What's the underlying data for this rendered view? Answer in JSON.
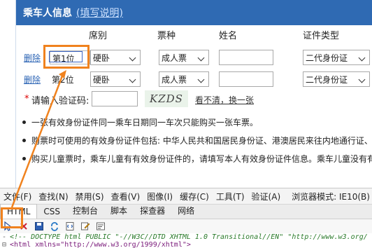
{
  "form": {
    "title": "乘车人信息",
    "title_hint": "(填写说明)",
    "columns": [
      "席别",
      "票种",
      "姓名",
      "证件类型"
    ],
    "rows": [
      {
        "delete": "删除",
        "seat": "第1位",
        "seat_class": "硬卧",
        "ticket_type": "成人票",
        "id_type": "二代身份证"
      },
      {
        "delete": "删除",
        "seat": "第2位",
        "seat_class": "硬卧",
        "ticket_type": "成人票",
        "id_type": "二代身份证"
      }
    ],
    "verify": {
      "label": "请输入验证码:",
      "captcha": "KZDS",
      "refresh": "看不清，换一张"
    },
    "notes": [
      "一张有效身份证件同一乘车日期同一车次只能购买一张车票。",
      "购票时可使用的有效身份证件包括: 中华人民共和国居民身份证、港澳居民来往内地通行证、台湾居民来往大陆通行证",
      "购买儿童票时，乘车儿童有有效身份证件的，请填写本人有效身份证件信息。乘车儿童没有有效身份证件的"
    ]
  },
  "devtools": {
    "menu": [
      "文件(F)",
      "查找(N)",
      "禁用(S)",
      "查看(V)",
      "图像(I)",
      "缓存(C)",
      "工具(T)",
      "验证(A)"
    ],
    "browser_mode": "浏览器模式: IE10(B)",
    "tabs": [
      "HTML",
      "CSS",
      "控制台",
      "脚本",
      "探查器",
      "网络"
    ],
    "active_tab": "HTML",
    "toolbar_icons": [
      "select-element-icon",
      "clear-icon",
      "save-icon",
      "refresh-icon",
      "dom-view-icon",
      "edit-icon",
      "word-wrap-icon"
    ],
    "code_lines": [
      "<!-- DOCTYPE html PUBLIC \"-//W3C//DTD XHTML 1.0 Transitional//EN\" \"http://www.w3.org/",
      "<html xmlns=\"http://www.w3.org/1999/xhtml\">"
    ]
  },
  "colors": {
    "header_blue": "#2f6ab3",
    "highlight_orange": "#f0821e",
    "link_blue": "#2a63b4"
  }
}
